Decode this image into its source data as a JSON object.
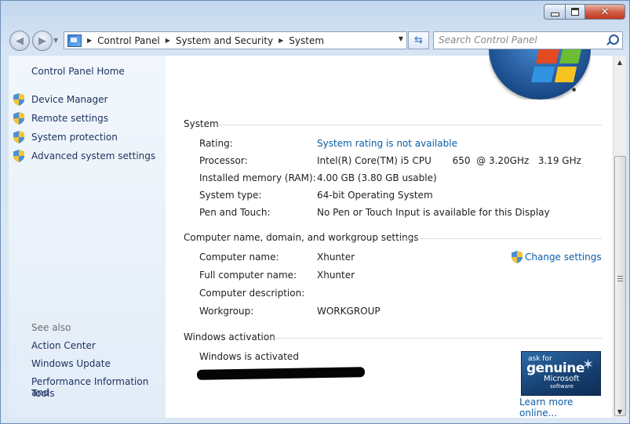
{
  "window": {
    "buttons": {
      "minimize": "minimize",
      "maximize": "maximize",
      "close": "close"
    }
  },
  "address_bar": {
    "breadcrumbs": [
      "Control Panel",
      "System and Security",
      "System"
    ],
    "icon": "control-panel-icon"
  },
  "search": {
    "placeholder": "Search Control Panel"
  },
  "sidebar": {
    "home": "Control Panel Home",
    "tasks": [
      {
        "label": "Device Manager",
        "icon": "shield-icon"
      },
      {
        "label": "Remote settings",
        "icon": "shield-icon"
      },
      {
        "label": "System protection",
        "icon": "shield-icon"
      },
      {
        "label": "Advanced system settings",
        "icon": "shield-icon"
      }
    ],
    "see_also": {
      "heading": "See also",
      "links": [
        "Action Center",
        "Windows Update",
        "Performance Information and",
        "Tools"
      ]
    }
  },
  "system": {
    "heading": "System",
    "rows": [
      {
        "label": "Rating:",
        "value": "System rating is not available",
        "is_link": true
      },
      {
        "label": "Processor:",
        "value": "Intel(R) Core(TM) i5 CPU       650  @ 3.20GHz   3.19 GHz"
      },
      {
        "label": "Installed memory (RAM):",
        "value": "4.00 GB (3.80 GB usable)"
      },
      {
        "label": "System type:",
        "value": "64-bit Operating System"
      },
      {
        "label": "Pen and Touch:",
        "value": "No Pen or Touch Input is available for this Display"
      }
    ]
  },
  "computer_name": {
    "heading": "Computer name, domain, and workgroup settings",
    "change_settings": "Change settings",
    "rows": [
      {
        "label": "Computer name:",
        "value": "Xhunter"
      },
      {
        "label": "Full computer name:",
        "value": "Xhunter"
      },
      {
        "label": "Computer description:",
        "value": ""
      },
      {
        "label": "Workgroup:",
        "value": "WORKGROUP"
      }
    ]
  },
  "activation": {
    "heading": "Windows activation",
    "status": "Windows is activated",
    "genuine_badge": {
      "line1": "ask for",
      "line2": "genuine",
      "line3": "Microsoft",
      "line4": "software"
    },
    "learn_more": "Learn more online..."
  },
  "colors": {
    "link": "#0b5ea7",
    "sidebar_link": "#1e3262",
    "sidebar_bg": "#e8f0f8"
  }
}
